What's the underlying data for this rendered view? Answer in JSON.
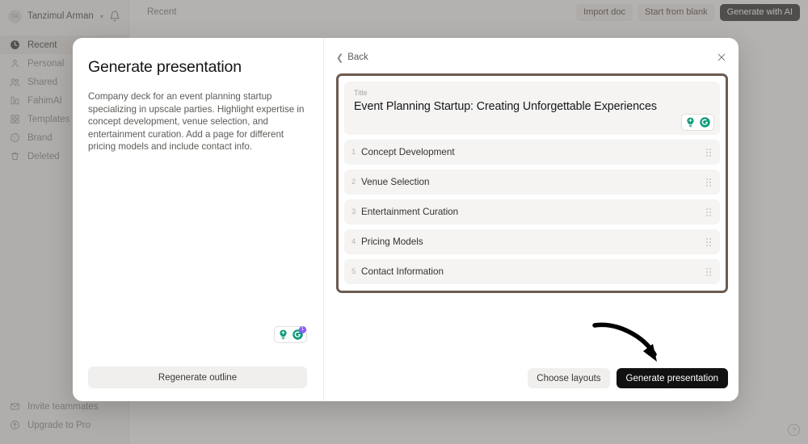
{
  "sidebar": {
    "user": {
      "initials": "TA",
      "name": "Tanzimul Arman",
      "chevron": "∨",
      "bell_icon": "bell-icon"
    },
    "items": [
      {
        "label": "Recent",
        "icon": "clock-icon",
        "active": true
      },
      {
        "label": "Personal",
        "icon": "person-icon",
        "active": false
      },
      {
        "label": "Shared",
        "icon": "people-icon",
        "active": false
      },
      {
        "label": "FahimAI",
        "icon": "building-icon",
        "active": false
      },
      {
        "label": "Templates",
        "icon": "grid-icon",
        "active": false
      },
      {
        "label": "Brand",
        "icon": "palette-icon",
        "active": false
      },
      {
        "label": "Deleted",
        "icon": "trash-icon",
        "active": false
      }
    ],
    "footer": [
      {
        "label": "Invite teammates",
        "icon": "envelope-icon"
      },
      {
        "label": "Upgrade to Pro",
        "icon": "arrow-up-circle-icon"
      }
    ]
  },
  "topbar": {
    "breadcrumb": "Recent",
    "actions": [
      {
        "label": "Import doc",
        "style": "ghost"
      },
      {
        "label": "Start from blank",
        "style": "ghost"
      },
      {
        "label": "Generate with AI",
        "style": "dark"
      }
    ],
    "help_icon": "question-mark-icon",
    "help_label": "?"
  },
  "modal": {
    "left": {
      "title": "Generate presentation",
      "description": "Company deck for an event planning startup specializing in upscale parties. Highlight expertise in concept development, venue selection, and entertainment curation. Add a page for different pricing models and include contact info.",
      "regenerate_label": "Regenerate outline",
      "grammarly": {
        "bulb_icon": "lightbulb-plus-icon",
        "circle_icon": "grammarly-g-icon",
        "count": "1"
      }
    },
    "right": {
      "back_label": "Back",
      "back_icon": "chevron-left-icon",
      "close_icon": "close-x-icon",
      "title_label": "Title",
      "title_value": "Event Planning Startup: Creating Unforgettable Experiences",
      "title_grammarly": {
        "bulb_icon": "lightbulb-plus-icon",
        "circle_icon": "grammarly-g-icon"
      },
      "outline": [
        {
          "num": "1",
          "label": "Concept Development"
        },
        {
          "num": "2",
          "label": "Venue Selection"
        },
        {
          "num": "3",
          "label": "Entertainment Curation"
        },
        {
          "num": "4",
          "label": "Pricing Models"
        },
        {
          "num": "5",
          "label": "Contact Information"
        }
      ],
      "choose_layouts_label": "Choose layouts",
      "generate_label": "Generate presentation"
    }
  },
  "annotation": {
    "arrow_icon": "curved-arrow-icon"
  },
  "colors": {
    "accent_teal": "#0e9b7c",
    "badge_purple": "#8b5cf6",
    "highlight_border": "#6b5b50",
    "dark_button": "#111111"
  }
}
